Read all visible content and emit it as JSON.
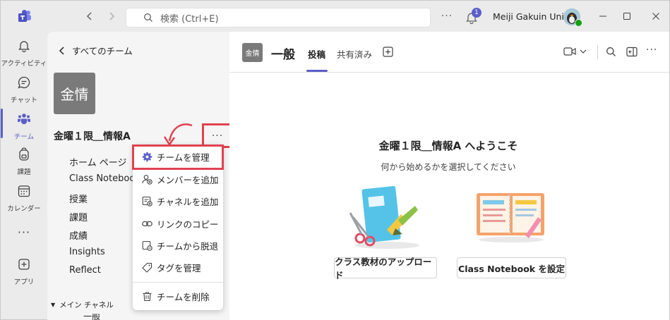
{
  "titlebar": {
    "search_placeholder": "検索 (Ctrl+E)",
    "notification_count": "1",
    "user_name": "Meiji Gakuin Univ..."
  },
  "rail": {
    "items": [
      {
        "label": "アクティビティ",
        "icon": "bell-icon"
      },
      {
        "label": "チャット",
        "icon": "chat-icon"
      },
      {
        "label": "チーム",
        "icon": "teams-icon"
      },
      {
        "label": "課題",
        "icon": "backpack-icon"
      },
      {
        "label": "カレンダー",
        "icon": "calendar-icon"
      },
      {
        "label": "アプリ",
        "icon": "add-apps-icon"
      }
    ],
    "more": "···"
  },
  "pane": {
    "back_label": "すべてのチーム",
    "team_avatar_text": "金情",
    "team_name": "金曜１限＿情報A",
    "more_label": "···",
    "nav": [
      "ホーム ページ",
      "Class Notebook",
      "授業",
      "課題",
      "成績",
      "Insights",
      "Reflect"
    ],
    "channel_section": "メイン チャネル",
    "channel_partial": "一般"
  },
  "menu": {
    "items": [
      {
        "label": "チームを管理",
        "icon": "gear-icon"
      },
      {
        "label": "メンバーを追加",
        "icon": "add-person-icon"
      },
      {
        "label": "チャネルを追加",
        "icon": "add-channel-icon"
      },
      {
        "label": "リンクのコピー",
        "icon": "link-icon"
      },
      {
        "label": "チームから脱退",
        "icon": "leave-team-icon"
      },
      {
        "label": "タグを管理",
        "icon": "tag-icon"
      },
      {
        "label": "チームを削除",
        "icon": "trash-icon"
      }
    ]
  },
  "channel_header": {
    "avatar_text": "金情",
    "title": "一般",
    "tabs": [
      "投稿",
      "共有済み"
    ],
    "active_tab": "投稿"
  },
  "welcome": {
    "title": "金曜１限＿情報A へようこそ",
    "subtitle": "何から始めるかを選択してください",
    "upload_button": "クラス教材のアップロード",
    "notebook_button": "Class Notebook を設定"
  },
  "colors": {
    "accent": "#5b5fc7",
    "highlight": "#e0424f",
    "notification_badge": "#5b5fc7"
  }
}
